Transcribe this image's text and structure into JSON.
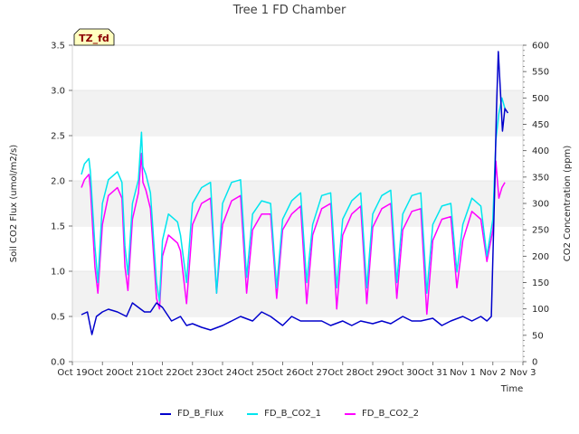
{
  "chart_data": {
    "type": "line",
    "title": "Tree 1 FD Chamber",
    "xlabel": "Time",
    "ylabel_left": "Soil CO2 Flux (umol/m2/s)",
    "ylabel_right": "CO2 Concentration (ppm)",
    "badge": "TZ_fd",
    "x_ticks": [
      "Oct 19",
      "Oct 20",
      "Oct 21",
      "Oct 22",
      "Oct 23",
      "Oct 24",
      "Oct 25",
      "Oct 26",
      "Oct 27",
      "Oct 28",
      "Oct 29",
      "Oct 30",
      "Oct 31",
      "Nov 1",
      "Nov 2",
      "Nov 3"
    ],
    "x_range_days": [
      0,
      15
    ],
    "y_left_ticks": [
      "0.0",
      "0.5",
      "1.0",
      "1.5",
      "2.0",
      "2.5",
      "3.0",
      "3.5"
    ],
    "y_left_range": [
      0,
      3.5
    ],
    "y_right_ticks": [
      "0",
      "50",
      "100",
      "150",
      "200",
      "250",
      "300",
      "350",
      "400",
      "450",
      "500",
      "550",
      "600"
    ],
    "y_right_range": [
      0,
      600
    ],
    "grid": "horizontal bands",
    "legend_position": "bottom",
    "series": [
      {
        "name": "FD_B_Flux",
        "axis": "left",
        "color": "#0000cc",
        "x": [
          0.3,
          0.5,
          0.65,
          0.8,
          1.0,
          1.2,
          1.5,
          1.8,
          2.0,
          2.2,
          2.4,
          2.6,
          2.8,
          3.0,
          3.3,
          3.6,
          3.8,
          4.0,
          4.3,
          4.6,
          5.0,
          5.3,
          5.6,
          6.0,
          6.3,
          6.6,
          7.0,
          7.3,
          7.6,
          8.0,
          8.3,
          8.6,
          9.0,
          9.3,
          9.6,
          10.0,
          10.3,
          10.6,
          11.0,
          11.3,
          11.6,
          12.0,
          12.3,
          12.6,
          13.0,
          13.3,
          13.6,
          13.8,
          13.95,
          14.05,
          14.12,
          14.18,
          14.25,
          14.32,
          14.4,
          14.5
        ],
        "y": [
          0.52,
          0.55,
          0.3,
          0.5,
          0.55,
          0.58,
          0.55,
          0.5,
          0.65,
          0.6,
          0.55,
          0.55,
          0.65,
          0.6,
          0.45,
          0.5,
          0.4,
          0.42,
          0.38,
          0.35,
          0.4,
          0.45,
          0.5,
          0.45,
          0.55,
          0.5,
          0.4,
          0.5,
          0.45,
          0.45,
          0.45,
          0.4,
          0.45,
          0.4,
          0.45,
          0.42,
          0.45,
          0.42,
          0.5,
          0.45,
          0.45,
          0.48,
          0.4,
          0.45,
          0.5,
          0.45,
          0.5,
          0.45,
          0.5,
          1.8,
          2.8,
          3.43,
          3.0,
          2.55,
          2.8,
          2.75
        ]
      },
      {
        "name": "FD_B_CO2_1",
        "axis": "right",
        "color": "#00e5ee",
        "x": [
          0.3,
          0.4,
          0.55,
          0.6,
          0.75,
          0.85,
          1.0,
          1.2,
          1.5,
          1.65,
          1.75,
          1.85,
          2.0,
          2.2,
          2.3,
          2.35,
          2.45,
          2.6,
          2.8,
          2.9,
          3.0,
          3.2,
          3.5,
          3.6,
          3.8,
          4.0,
          4.3,
          4.6,
          4.8,
          5.0,
          5.3,
          5.6,
          5.8,
          6.0,
          6.3,
          6.6,
          6.8,
          7.0,
          7.3,
          7.6,
          7.8,
          8.0,
          8.3,
          8.6,
          8.8,
          9.0,
          9.3,
          9.6,
          9.8,
          10.0,
          10.3,
          10.6,
          10.8,
          11.0,
          11.3,
          11.6,
          11.8,
          12.0,
          12.3,
          12.6,
          12.8,
          13.0,
          13.3,
          13.6,
          13.8,
          14.0,
          14.1,
          14.2,
          14.3,
          14.4
        ],
        "y": [
          355,
          375,
          385,
          360,
          220,
          150,
          300,
          345,
          360,
          340,
          220,
          165,
          300,
          345,
          435,
          370,
          355,
          320,
          150,
          115,
          230,
          280,
          265,
          240,
          150,
          300,
          330,
          340,
          130,
          300,
          340,
          345,
          160,
          280,
          305,
          300,
          140,
          270,
          305,
          320,
          150,
          260,
          315,
          320,
          140,
          270,
          305,
          320,
          140,
          280,
          315,
          325,
          150,
          280,
          315,
          320,
          130,
          260,
          295,
          300,
          170,
          260,
          310,
          295,
          200,
          270,
          420,
          470,
          500,
          480
        ]
      },
      {
        "name": "FD_B_CO2_2",
        "axis": "right",
        "color": "#ff00ff",
        "x": [
          0.3,
          0.4,
          0.55,
          0.6,
          0.75,
          0.85,
          1.0,
          1.2,
          1.5,
          1.65,
          1.75,
          1.85,
          2.0,
          2.2,
          2.3,
          2.35,
          2.45,
          2.6,
          2.8,
          2.9,
          3.0,
          3.2,
          3.5,
          3.6,
          3.8,
          4.0,
          4.3,
          4.6,
          4.8,
          5.0,
          5.3,
          5.6,
          5.8,
          6.0,
          6.3,
          6.6,
          6.8,
          7.0,
          7.3,
          7.6,
          7.8,
          8.0,
          8.3,
          8.6,
          8.8,
          9.0,
          9.3,
          9.6,
          9.8,
          10.0,
          10.3,
          10.6,
          10.8,
          11.0,
          11.3,
          11.6,
          11.8,
          12.0,
          12.3,
          12.6,
          12.8,
          13.0,
          13.3,
          13.6,
          13.8,
          14.0,
          14.1,
          14.2,
          14.3,
          14.4
        ],
        "y": [
          330,
          345,
          355,
          330,
          180,
          130,
          260,
          315,
          330,
          310,
          180,
          135,
          270,
          320,
          395,
          340,
          325,
          290,
          120,
          100,
          200,
          240,
          225,
          210,
          110,
          260,
          300,
          310,
          130,
          260,
          305,
          315,
          130,
          250,
          280,
          280,
          120,
          250,
          280,
          295,
          110,
          240,
          290,
          300,
          100,
          240,
          280,
          295,
          110,
          255,
          290,
          300,
          120,
          250,
          285,
          290,
          90,
          230,
          270,
          275,
          140,
          230,
          285,
          270,
          190,
          250,
          380,
          310,
          330,
          340
        ]
      }
    ]
  }
}
